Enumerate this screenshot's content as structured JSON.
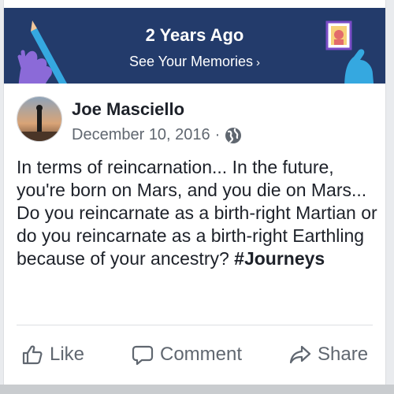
{
  "memories_banner": {
    "title": "2 Years Ago",
    "link_label": "See Your Memories",
    "link_chevron": "›",
    "background_color": "#233b6b"
  },
  "post": {
    "author_name": "Joe Masciello",
    "date": "December 10, 2016",
    "separator": "·",
    "privacy_icon": "globe-icon",
    "text": "In terms of reincarnation... In the future, you're born on Mars, and you die on Mars... Do you reincarnate as a birth-right Martian or do you reincarnate as a birth-right Earthling because of your ancestry? ",
    "hashtag": "#Journeys"
  },
  "actions": {
    "like_label": "Like",
    "comment_label": "Comment",
    "share_label": "Share",
    "icons": [
      "thumbs-up-icon",
      "comment-bubble-icon",
      "share-arrow-icon"
    ]
  },
  "colors": {
    "text_primary": "#1d2129",
    "text_secondary": "#606770"
  }
}
